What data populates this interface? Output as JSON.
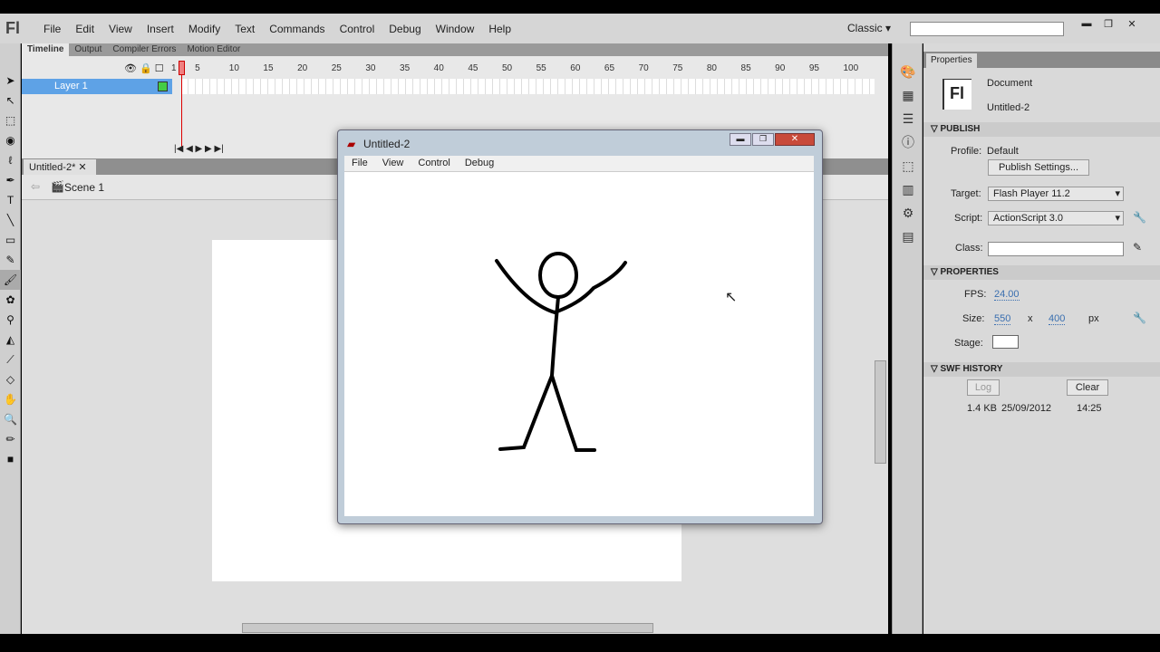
{
  "app": {
    "logo": "Fl",
    "menus": [
      "File",
      "Edit",
      "View",
      "Insert",
      "Modify",
      "Text",
      "Commands",
      "Control",
      "Debug",
      "Window",
      "Help"
    ],
    "workspace": "Classic",
    "search_placeholder": ""
  },
  "timeline": {
    "tabs": [
      "Timeline",
      "Output",
      "Compiler Errors",
      "Motion Editor"
    ],
    "layer": "Layer 1",
    "frame_numbers": [
      "1",
      "5",
      "10",
      "15",
      "20",
      "25",
      "30",
      "35",
      "40",
      "45",
      "50",
      "55",
      "60",
      "65",
      "70",
      "75",
      "80",
      "85",
      "90",
      "95",
      "100"
    ],
    "current_frame": 1
  },
  "document": {
    "tab": "Untitled-2*",
    "scene": "Scene 1"
  },
  "popup": {
    "title": "Untitled-2",
    "menus": [
      "File",
      "View",
      "Control",
      "Debug"
    ]
  },
  "properties": {
    "tab": "Properties",
    "doc_type": "Document",
    "doc_name": "Untitled-2",
    "publish": {
      "header": "PUBLISH",
      "profile_label": "Profile:",
      "profile": "Default",
      "settings_button": "Publish Settings...",
      "target_label": "Target:",
      "target": "Flash Player 11.2",
      "script_label": "Script:",
      "script": "ActionScript 3.0",
      "class_label": "Class:",
      "class_value": ""
    },
    "props": {
      "header": "PROPERTIES",
      "fps_label": "FPS:",
      "fps": "24.00",
      "size_label": "Size:",
      "width": "550",
      "x": "x",
      "height": "400",
      "unit": "px",
      "stage_label": "Stage:",
      "stage_color": "#ffffff"
    },
    "history": {
      "header": "SWF HISTORY",
      "log": "Log",
      "clear": "Clear",
      "size": "1.4 KB",
      "date": "25/09/2012",
      "time": "14:25"
    }
  }
}
